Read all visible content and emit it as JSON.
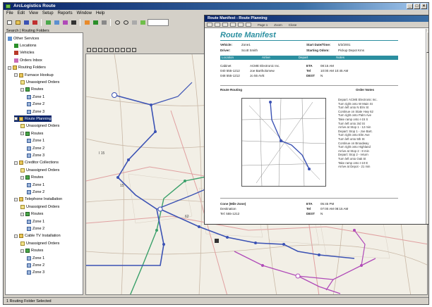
{
  "window": {
    "title": "ArcLogistics Route"
  },
  "menu": [
    "File",
    "Edit",
    "View",
    "Setup",
    "Reports",
    "Window",
    "Help"
  ],
  "toolbar": {
    "icons": [
      "new-icon",
      "open-icon",
      "save-icon",
      "print-icon",
      "cut-icon",
      "copy-icon",
      "paste-icon",
      "undo-icon",
      "build-route-icon",
      "sequence-icon",
      "zoom-in-icon",
      "zoom-out-icon",
      "pan-icon",
      "identify-icon",
      "full-extent-icon",
      "map-layers-icon"
    ]
  },
  "tree": {
    "header": "Search | Routing Folders",
    "items": [
      {
        "label": "Other Services",
        "depth": 0,
        "icon": "svc"
      },
      {
        "label": "Locations",
        "depth": 1,
        "icon": "loc"
      },
      {
        "label": "Vehicles",
        "depth": 1,
        "icon": "veh"
      },
      {
        "label": "Orders Inbox",
        "depth": 1,
        "icon": "ord"
      },
      {
        "label": "Routing Folders",
        "depth": 0,
        "icon": "folder"
      },
      {
        "label": "Furnace Hookup",
        "depth": 1,
        "icon": "folder"
      },
      {
        "label": "Unassigned Orders",
        "depth": 2,
        "icon": "orders"
      },
      {
        "label": "Routes",
        "depth": 2,
        "icon": "route"
      },
      {
        "label": "Zone 1",
        "depth": 3,
        "icon": "zone"
      },
      {
        "label": "Zone 2",
        "depth": 3,
        "icon": "zone"
      },
      {
        "label": "Zone 3",
        "depth": 3,
        "icon": "zone"
      },
      {
        "label": "Route Planning",
        "depth": 1,
        "icon": "folder",
        "selected": true
      },
      {
        "label": "Unassigned Orders",
        "depth": 2,
        "icon": "orders"
      },
      {
        "label": "Routes",
        "depth": 2,
        "icon": "route"
      },
      {
        "label": "Zone 1",
        "depth": 3,
        "icon": "zone"
      },
      {
        "label": "Zone 2",
        "depth": 3,
        "icon": "zone"
      },
      {
        "label": "Zone 3",
        "depth": 3,
        "icon": "zone"
      },
      {
        "label": "Creditor Collections",
        "depth": 1,
        "icon": "folder"
      },
      {
        "label": "Unassigned Orders",
        "depth": 2,
        "icon": "orders"
      },
      {
        "label": "Routes",
        "depth": 2,
        "icon": "route"
      },
      {
        "label": "Zone 1",
        "depth": 3,
        "icon": "zone"
      },
      {
        "label": "Zone 2",
        "depth": 3,
        "icon": "zone"
      },
      {
        "label": "Telephone Installation",
        "depth": 1,
        "icon": "folder"
      },
      {
        "label": "Unassigned Orders",
        "depth": 2,
        "icon": "orders"
      },
      {
        "label": "Routes",
        "depth": 2,
        "icon": "route"
      },
      {
        "label": "Zone 1",
        "depth": 3,
        "icon": "zone"
      },
      {
        "label": "Zone 2",
        "depth": 3,
        "icon": "zone"
      },
      {
        "label": "Cable TV Installation",
        "depth": 1,
        "icon": "folder"
      },
      {
        "label": "Unassigned Orders",
        "depth": 2,
        "icon": "orders"
      },
      {
        "label": "Routes",
        "depth": 2,
        "icon": "route"
      },
      {
        "label": "Zone 1",
        "depth": 3,
        "icon": "zone"
      },
      {
        "label": "Zone 2",
        "depth": 3,
        "icon": "zone"
      },
      {
        "label": "Zone 3",
        "depth": 3,
        "icon": "zone"
      }
    ]
  },
  "map": {
    "route_colors": {
      "blue": "#3b52b4",
      "green": "#3aa06a",
      "purple": "#b04ab8"
    },
    "labels": [
      "I 15",
      "15",
      "62"
    ]
  },
  "manifest": {
    "window_title": "Route Manifest - Route Planning",
    "toolbar_text": [
      "Page 1",
      "Zoom",
      "Close"
    ],
    "heading": "Route Manifest",
    "fields": [
      {
        "label": "Vehicle:",
        "value": "Zone1"
      },
      {
        "label": "Driver:",
        "value": "Scott Smith"
      },
      {
        "label": "Start Date/Time:",
        "value": "5/3/2001"
      },
      {
        "label": "Starting Odom:",
        "value": "Pickup Depot Kms"
      }
    ],
    "band": [
      "Location",
      "Arrive",
      "Depart",
      "Notes"
    ],
    "stops": [
      {
        "a": "Cabinet",
        "b": "ACME Electronic Inc.",
        "c": "ETA",
        "d": "08:15 AM"
      },
      {
        "a": "040  555-1212",
        "b": "Joe Bartholomew",
        "c": "Tel",
        "d": "10:00 AM  10:45 AM"
      },
      {
        "a": "048  555-1212",
        "b": "Jo   55 AVE",
        "c": "DEST",
        "d": "N"
      }
    ],
    "section": "Route Routing",
    "section_right": "Order Notes",
    "directions": [
      "Depart: ACME Electronic Inc.",
      "Turn right onto W Main St",
      "Turn left onto N Elm St",
      "Continue on State Hwy 62",
      "Turn right onto Palm Ave",
      "Take ramp onto I-15 S",
      "Turn left onto 3rd St",
      "Arrive at Stop 1 - 12 min",
      "Depart: Stop 1 - Joe Bart.",
      "Turn right onto Elm Ave",
      "Turn left onto 5th St",
      "Continue on Broadway",
      "Turn right onto Highland",
      "Arrive at Stop 2 - 8 min",
      "Depart: Stop 2 - return",
      "Turn left onto Oak St",
      "Take ramp onto I-10 E",
      "Arrive at Depot - 21 min"
    ],
    "footer_left": [
      "Cone (Mile Zone)",
      "Destination",
      "Tel:  555-1212"
    ],
    "footer_mid": [
      "ETA",
      "Tel",
      "DEST"
    ],
    "footer_right": [
      "05:45 PM",
      "07:00 AM  08:15 AM",
      "N"
    ]
  },
  "status": {
    "left": "1 Routing Folder Selected",
    "right": ""
  }
}
